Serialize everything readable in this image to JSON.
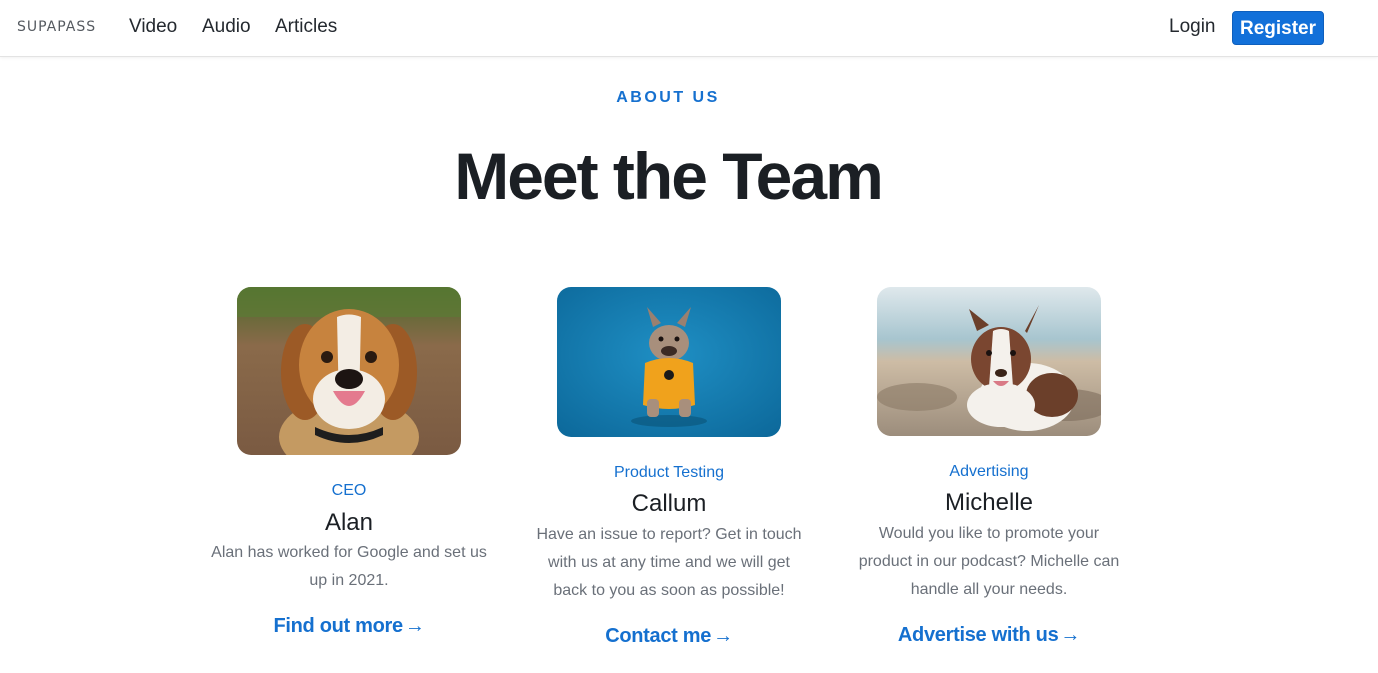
{
  "nav": {
    "logo": "SUPAPASS",
    "links": [
      "Video",
      "Audio",
      "Articles"
    ],
    "login": "Login",
    "register": "Register"
  },
  "header": {
    "eyebrow": "ABOUT US",
    "title": "Meet the Team"
  },
  "team": [
    {
      "role": "CEO",
      "name": "Alan",
      "bio": "Alan has worked for Google and set us up in 2021.",
      "cta": "Find out more",
      "arrow": "→",
      "photo_icon": "beagle-photo"
    },
    {
      "role": "Product Testing",
      "name": "Callum",
      "bio": "Have an issue to report? Get in touch with us at any time and we will get back to you as soon as possible!",
      "cta": "Contact me",
      "arrow": "→",
      "photo_icon": "french-bulldog-photo"
    },
    {
      "role": "Advertising",
      "name": "Michelle",
      "bio": "Would you like to promote your product in our podcast? Michelle can handle all your needs.",
      "cta": "Advertise with us",
      "arrow": "→",
      "photo_icon": "australian-shepherd-photo"
    }
  ],
  "colors": {
    "accent": "#1570cf",
    "register_bg": "#1270d9",
    "heading": "#1b1f24",
    "muted": "#6a7079"
  }
}
